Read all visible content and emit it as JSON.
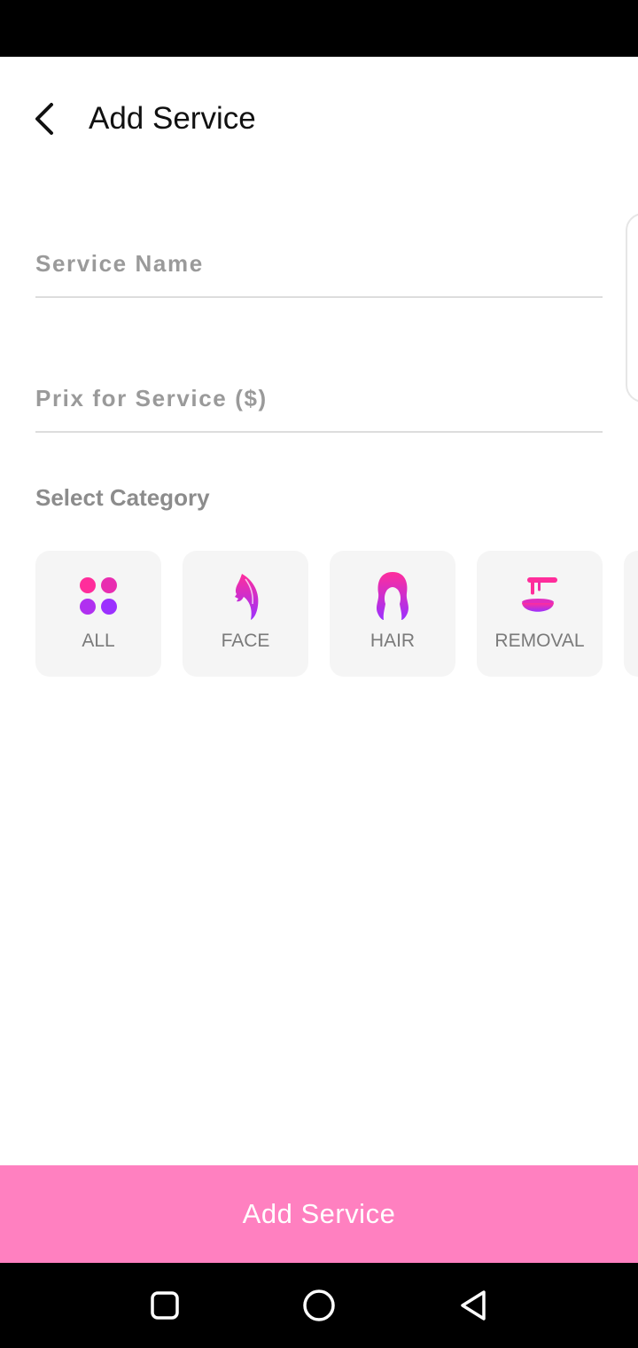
{
  "header": {
    "title": "Add Service",
    "back_icon": "chevron-left-icon"
  },
  "form": {
    "service_name_placeholder": "Service Name",
    "price_placeholder": "Prix for Service ($)"
  },
  "category_section": {
    "label": "Select Category",
    "items": [
      {
        "label": "ALL",
        "icon": "grid-dots-icon"
      },
      {
        "label": "FACE",
        "icon": "face-profile-icon"
      },
      {
        "label": "HAIR",
        "icon": "hair-icon"
      },
      {
        "label": "REMOVAL",
        "icon": "wax-bowl-icon"
      }
    ]
  },
  "submit_button": {
    "label": "Add Service"
  },
  "nav_bar": {
    "recents_icon": "square-icon",
    "home_icon": "circle-icon",
    "back_icon": "triangle-back-icon"
  },
  "colors": {
    "accent_pink": "#ff80c0",
    "gradient_start": "#ff2d9b",
    "gradient_end": "#9b30ff",
    "tile_background": "#f5f5f5"
  }
}
